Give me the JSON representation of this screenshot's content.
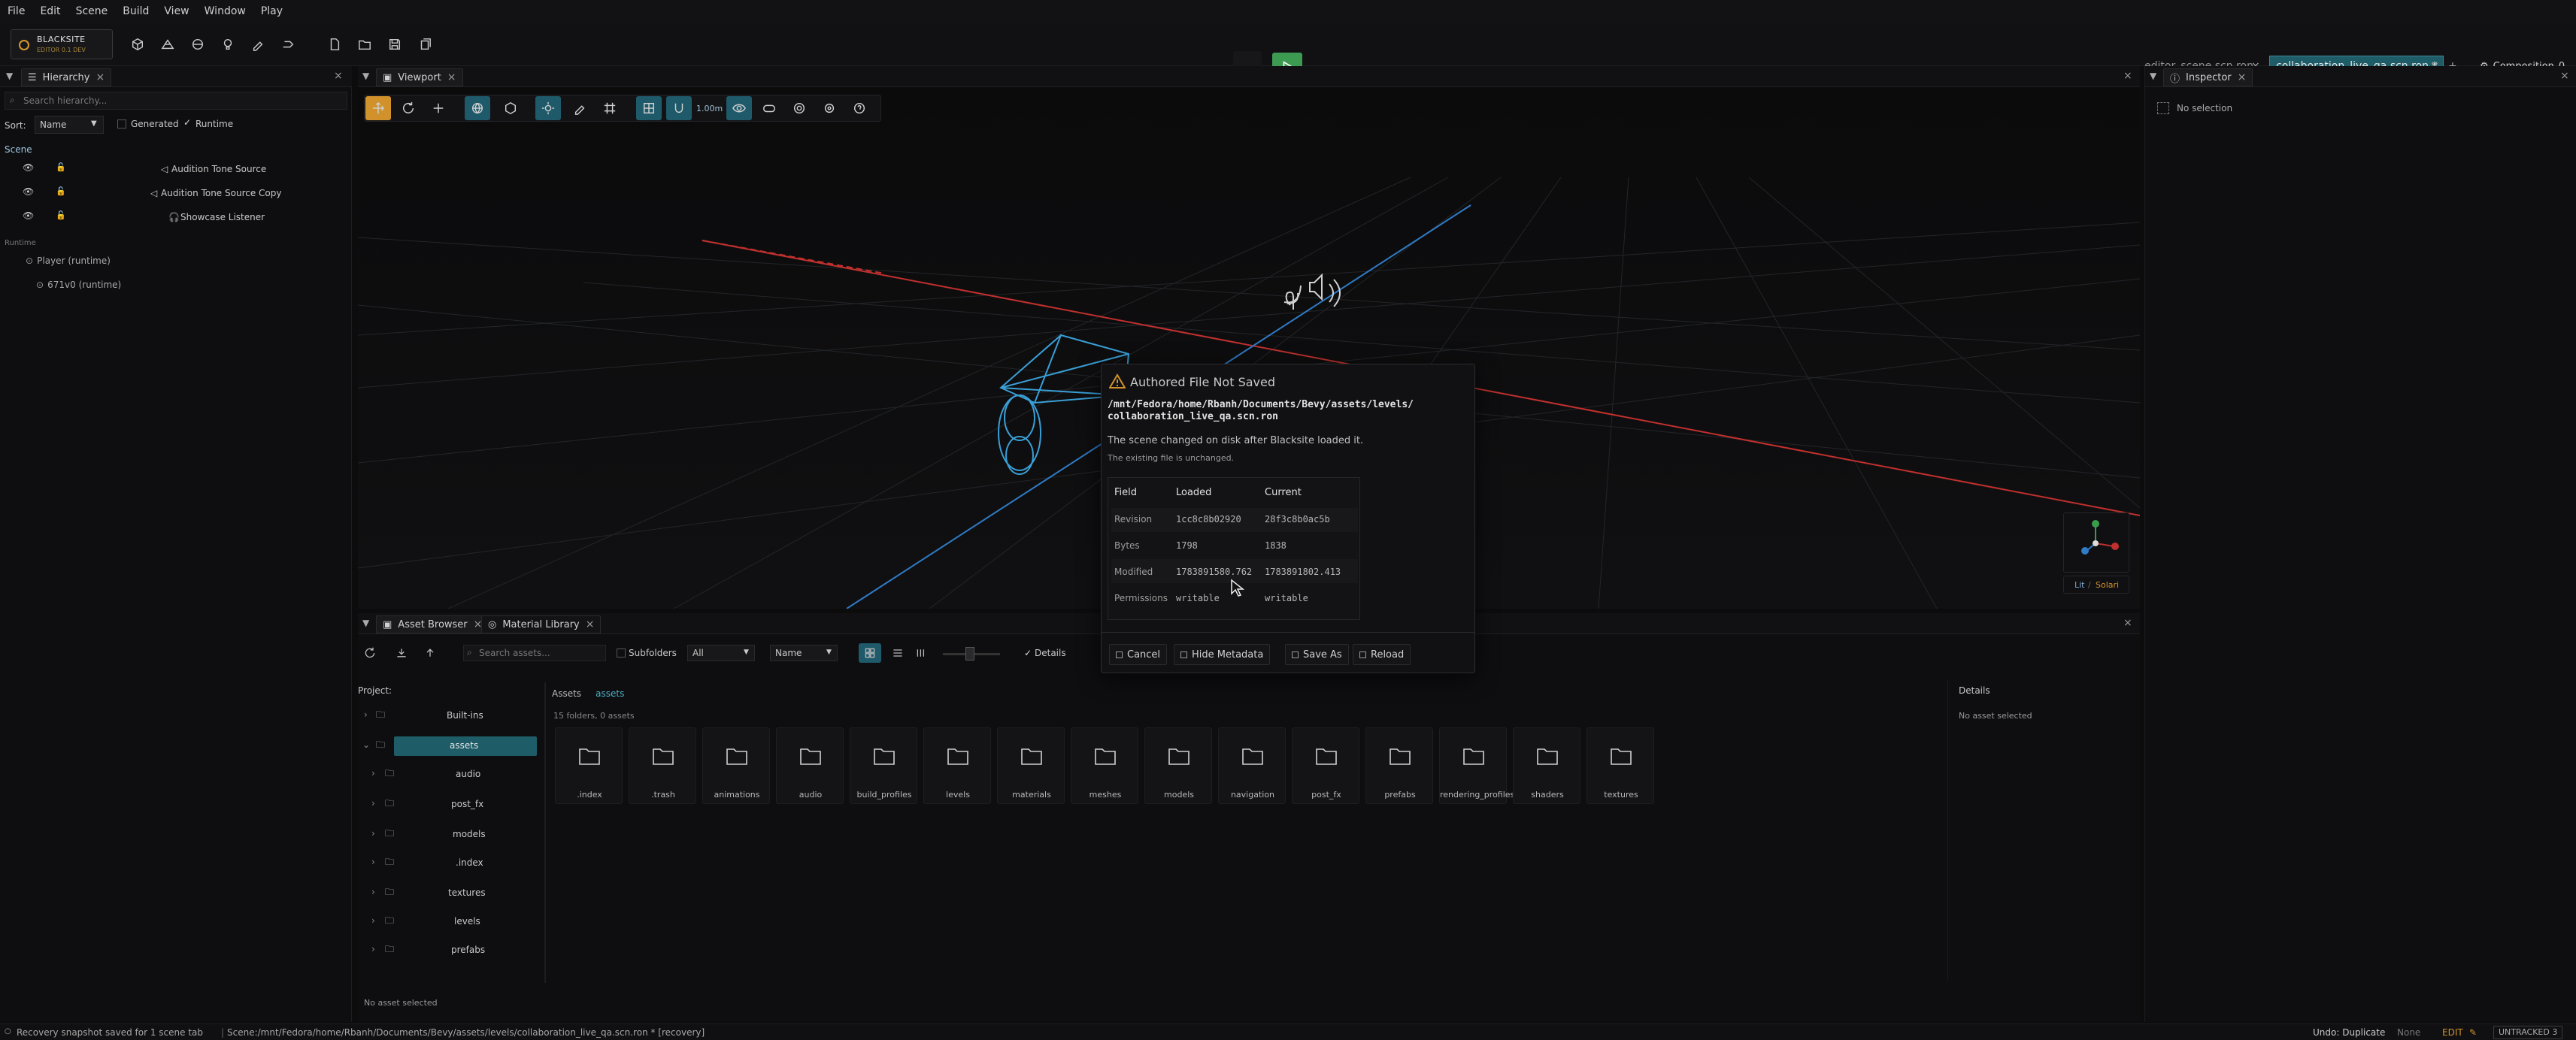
{
  "menu": [
    "File",
    "Edit",
    "Scene",
    "Build",
    "View",
    "Window",
    "Play"
  ],
  "logo": {
    "name": "BLACKSITE",
    "sub": "EDITOR 0.1 DEV"
  },
  "file_tabs": [
    {
      "label": "editor_scene.scn.ron",
      "active": false
    },
    {
      "label": "collaboration_live_qa.scn.ron *",
      "active": true
    }
  ],
  "layout_button": "Composition",
  "layout_count": "0",
  "hierarchy": {
    "tab": "Hierarchy",
    "search_placeholder": "Search hierarchy...",
    "sort_label": "Sort:",
    "sort_value": "Name",
    "generated_label": "Generated",
    "runtime_label": "Runtime",
    "scene_label": "Scene",
    "scene_items": [
      "Audition Tone Source",
      "Audition Tone Source Copy",
      "Showcase Listener"
    ],
    "runtime_section": "Runtime",
    "runtime_items": [
      "Player (runtime)",
      "671v0 (runtime)"
    ]
  },
  "viewport": {
    "tab": "Viewport",
    "snap": "1.00m",
    "axis_labels": {
      "lit": "Lit",
      "solari": "Solari"
    }
  },
  "inspector": {
    "tab": "Inspector",
    "empty": "No selection"
  },
  "modal": {
    "title": "Authored File Not Saved",
    "path": "/mnt/Fedora/home/Rbanh/Documents/Bevy/assets/levels/\ncollaboration_live_qa.scn.ron",
    "message": "The scene changed on disk after Blacksite loaded it.",
    "submessage": "The existing file is unchanged.",
    "headers": [
      "Field",
      "Loaded",
      "Current"
    ],
    "rows": [
      {
        "field": "Revision",
        "loaded": "1cc8c8b02920",
        "current": "28f3c8b0ac5b"
      },
      {
        "field": "Bytes",
        "loaded": "1798",
        "current": "1838"
      },
      {
        "field": "Modified",
        "loaded": "1783891580.762",
        "current": "1783891802.413"
      },
      {
        "field": "Permissions",
        "loaded": "writable",
        "current": "writable"
      }
    ],
    "buttons": [
      "Cancel",
      "Hide Metadata",
      "Save As",
      "Reload"
    ]
  },
  "assets": {
    "tabs": [
      "Asset Browser",
      "Material Library"
    ],
    "subfolders_label": "Subfolders",
    "filter_value": "All",
    "sort_value": "Name",
    "search_placeholder": "Search assets...",
    "details_toggle": "Details",
    "project_label": "Project:",
    "builtins": "Built-ins",
    "assets_root": "assets",
    "tree": [
      "audio",
      "post_fx",
      "models",
      ".index",
      "textures",
      "levels",
      "prefabs"
    ],
    "breadcrumb_root": "Assets",
    "breadcrumb_current": "assets",
    "count": "15 folders, 0 assets",
    "folders": [
      ".index",
      ".trash",
      "animations",
      "audio",
      "build_profiles",
      "levels",
      "materials",
      "meshes",
      "models",
      "navigation",
      "post_fx",
      "prefabs",
      "rendering_profiles",
      "shaders",
      "textures"
    ],
    "details_title": "Details",
    "details_empty": "No asset selected",
    "footer": "No asset selected"
  },
  "status": {
    "left": "Recovery snapshot saved for 1 scene tab",
    "scene": "Scene:/mnt/Fedora/home/Rbanh/Documents/Bevy/assets/levels/collaboration_live_qa.scn.ron * [recovery]",
    "undo": "Undo: Duplicate",
    "redo": "None",
    "mode": "EDIT",
    "vcs": "UNTRACKED 3"
  },
  "colors": {
    "accent": "#d1922b",
    "play": "#3d9b51",
    "teal": "#1f5a6a",
    "grid_line": "#3a86c8",
    "x_axis": "#c0302e"
  }
}
